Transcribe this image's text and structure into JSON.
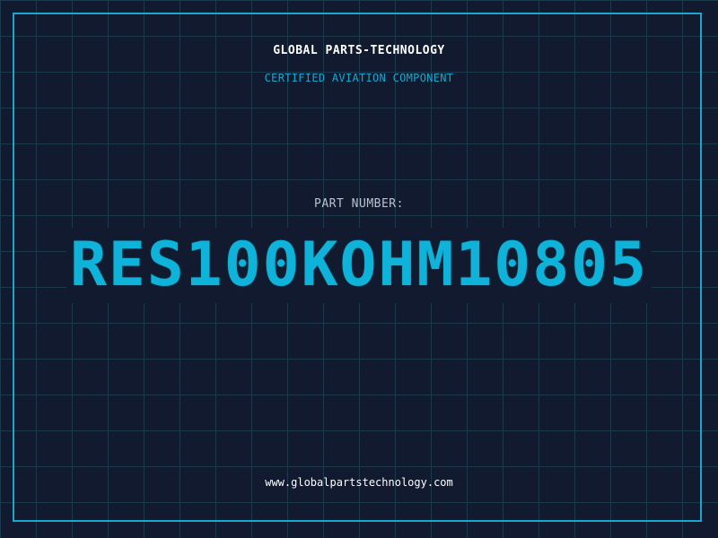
{
  "brand": {
    "name": "GLOBAL PARTS-TECHNOLOGY",
    "tagline": "CERTIFIED AVIATION COMPONENT"
  },
  "part": {
    "label": "PART NUMBER:",
    "number": "RES100KOHM10805"
  },
  "footer": {
    "url": "www.globalpartstechnology.com"
  },
  "colors": {
    "background": "#111a2e",
    "grid": "#1c3a4d",
    "accent": "#1aa7cf",
    "part_number": "#0fb2d9",
    "white": "#ffffff",
    "label": "#b9c3cc"
  }
}
